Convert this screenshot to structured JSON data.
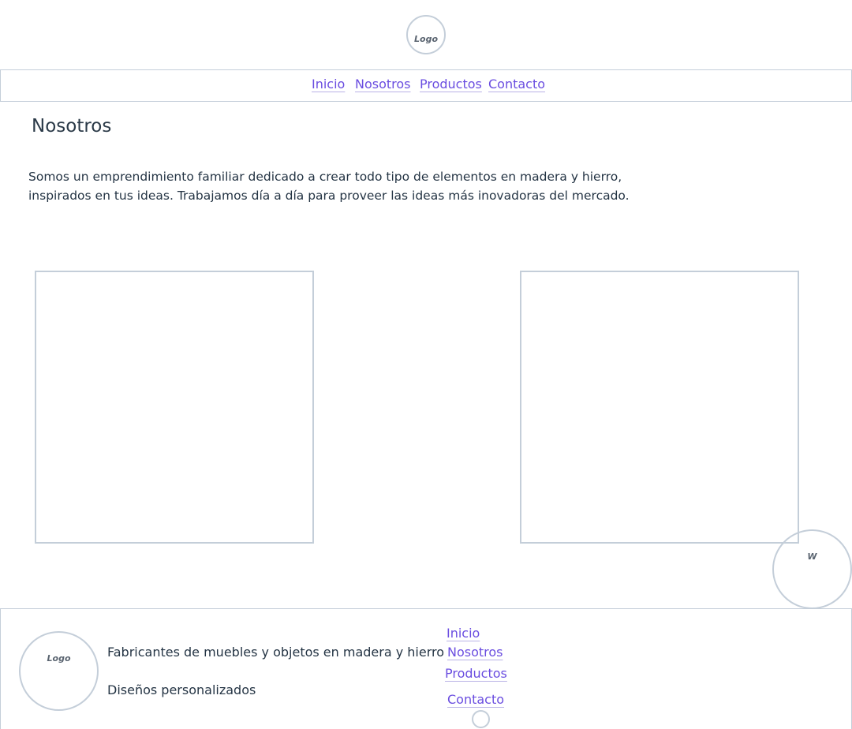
{
  "header": {
    "logo_text": "Logo"
  },
  "nav": {
    "items": [
      {
        "label": "Inicio"
      },
      {
        "label": "Nosotros"
      },
      {
        "label": "Productos"
      },
      {
        "label": "Contacto"
      }
    ]
  },
  "main": {
    "title": "Nosotros",
    "description": "Somos un emprendimiento familiar dedicado a crear todo tipo de elementos en madera y hierro, inspirados en tus ideas. Trabajamos día a día para proveer las ideas más inovadoras del mercado."
  },
  "floating": {
    "whatsapp_text": "W"
  },
  "footer": {
    "logo_text": "Logo",
    "tagline": "Fabricantes de muebles y objetos en madera y hierro",
    "subtagline": "Diseños personalizados",
    "links": [
      {
        "label": "Inicio"
      },
      {
        "label": "Nosotros"
      },
      {
        "label": "Productos"
      },
      {
        "label": "Contacto"
      }
    ]
  }
}
